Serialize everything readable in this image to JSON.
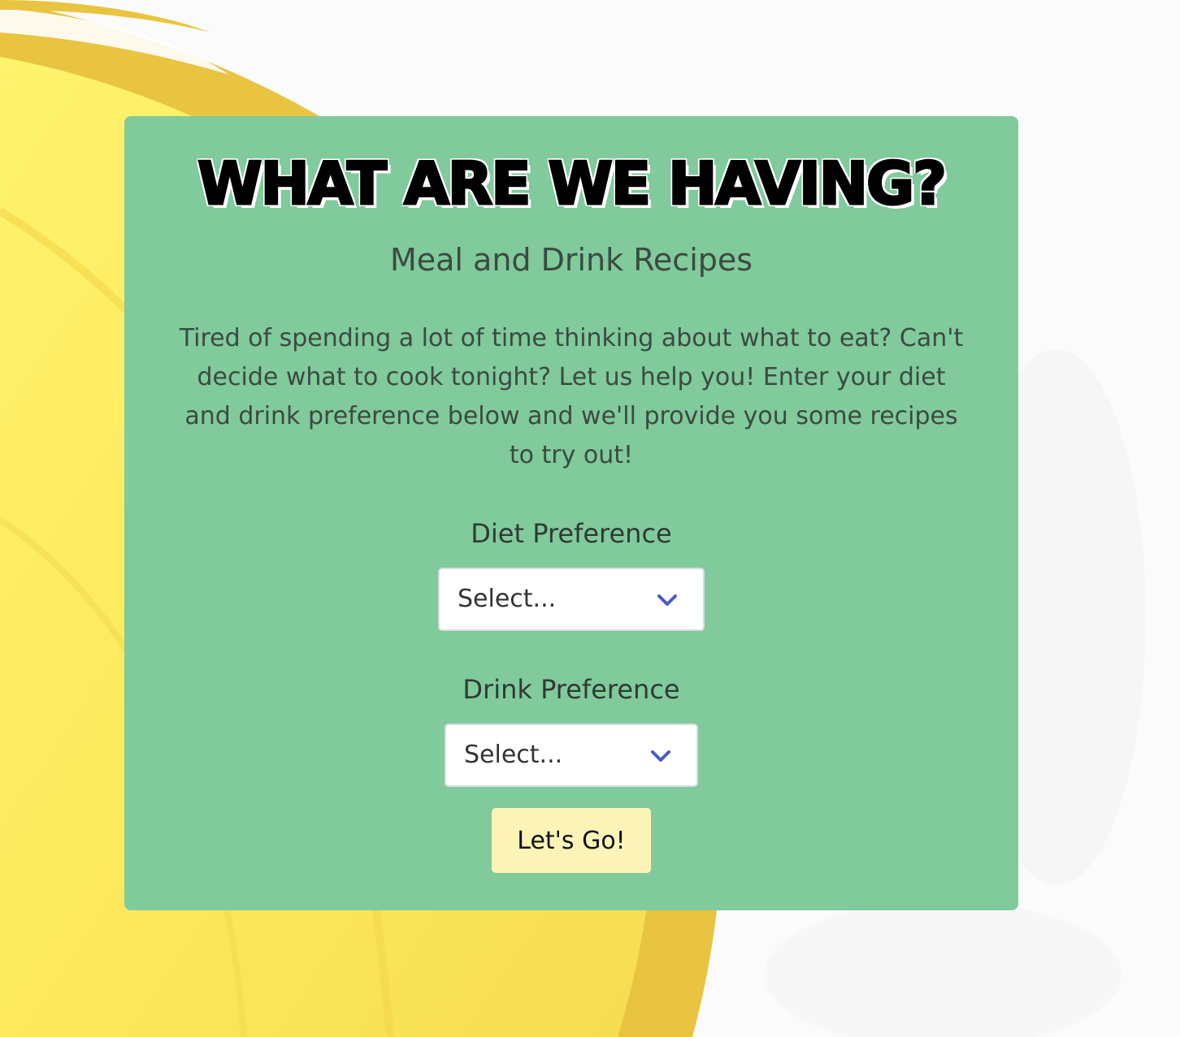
{
  "header": {
    "title": "WHAT ARE WE HAVING?",
    "subtitle": "Meal and Drink Recipes"
  },
  "intro": {
    "text": "Tired of spending a lot of time thinking about what to eat? Can't decide what to cook tonight? Let us help you! Enter your diet and drink preference below and we'll provide you some recipes to try out!"
  },
  "form": {
    "diet": {
      "label": "Diet Preference",
      "selected": "Select..."
    },
    "drink": {
      "label": "Drink Preference",
      "selected": "Select..."
    },
    "submit_label": "Let's Go!"
  },
  "colors": {
    "card": "#80ca9c",
    "button": "#fbf4b6",
    "chevron": "#4a5bc4",
    "lemon": "#fce95c",
    "lemon_rind": "#e9c440"
  },
  "icons": {
    "select_chevron": "chevron-down-icon"
  }
}
